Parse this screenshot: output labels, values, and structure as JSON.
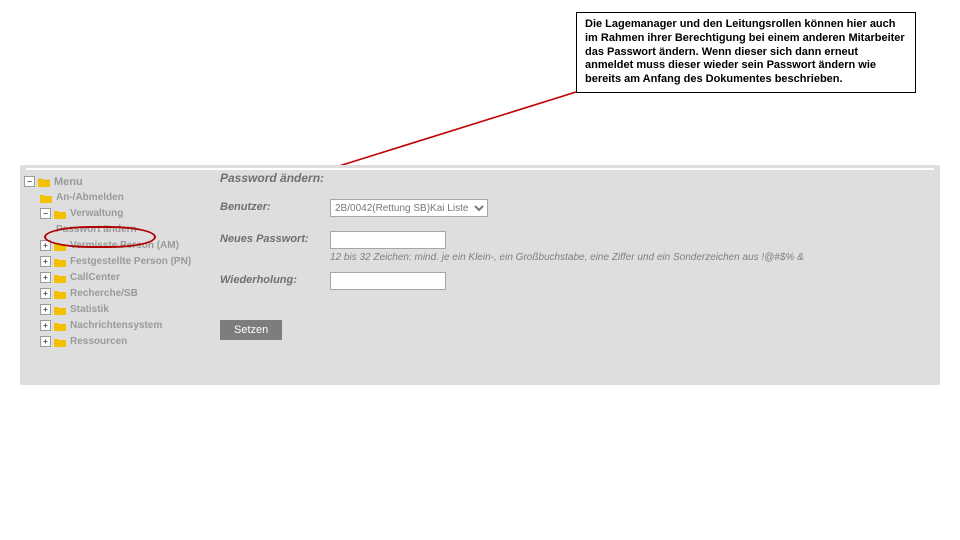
{
  "callout": {
    "text": "Die Lagemanager und den Leitungsrollen können hier auch im Rahmen ihrer Berechtigung bei einem anderen Mitarbeiter das Passwort ändern. Wenn dieser sich dann erneut anmeldet muss dieser wieder sein Passwort ändern wie bereits am Anfang des Dokumentes beschrieben."
  },
  "sidebar": {
    "root_label": "Menu",
    "items": [
      {
        "label": "An-/Abmelden"
      },
      {
        "label": "Verwaltung"
      },
      {
        "label": "Passwort ändern"
      },
      {
        "label": "Vermisste Person (AM)"
      },
      {
        "label": "Festgestellte Person (PN)"
      },
      {
        "label": "CallCenter"
      },
      {
        "label": "Recherche/SB"
      },
      {
        "label": "Statistik"
      },
      {
        "label": "Nachrichtensystem"
      },
      {
        "label": "Ressourcen"
      }
    ]
  },
  "content": {
    "title": "Password ändern:",
    "benutzer_label": "Benutzer:",
    "benutzer_value": "2B/0042(Rettung SB)Kai Liste",
    "neues_label": "Neues Passwort:",
    "hint": "12 bis 32 Zeichen: mind. je ein Klein-, ein Großbuchstabe, eine Ziffer und ein Sonderzeichen aus !@#$% &",
    "wdh_label": "Wiederholung:",
    "setzen_label": "Setzen"
  },
  "icons": {
    "open": "▾",
    "closed": "▸"
  }
}
